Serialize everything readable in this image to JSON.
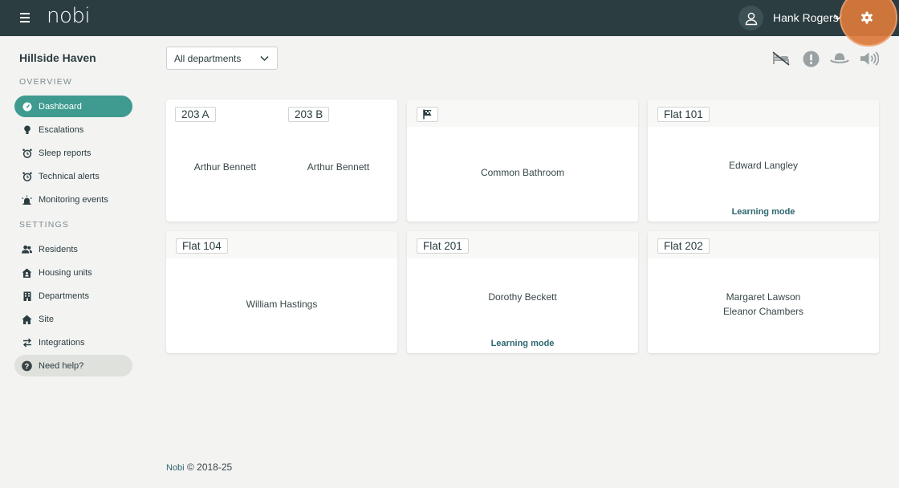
{
  "header": {
    "logo": "nobi",
    "user_name": "Hank Rogers",
    "icons": [
      "menu-icon",
      "user-icon",
      "chevron-down-icon",
      "gear-icon"
    ]
  },
  "sidebar": {
    "site_name": "Hillside Haven",
    "overview_label": "OVERVIEW",
    "settings_label": "SETTINGS",
    "overview_items": [
      {
        "label": "Dashboard",
        "icon": "gauge-icon",
        "active": true
      },
      {
        "label": "Escalations",
        "icon": "bulb-icon"
      },
      {
        "label": "Sleep reports",
        "icon": "alarm-clock-icon"
      },
      {
        "label": "Technical alerts",
        "icon": "alarm-clock-icon"
      },
      {
        "label": "Monitoring events",
        "icon": "siren-icon"
      }
    ],
    "settings_items": [
      {
        "label": "Residents",
        "icon": "users-icon"
      },
      {
        "label": "Housing units",
        "icon": "house-user-icon"
      },
      {
        "label": "Departments",
        "icon": "building-icon"
      },
      {
        "label": "Site",
        "icon": "home-icon"
      },
      {
        "label": "Integrations",
        "icon": "arrows-swap-icon"
      }
    ],
    "help_label": "Need help?"
  },
  "toolbar": {
    "department_filter": "All departments",
    "filter_icons": [
      "bed-icon",
      "alert-circle-icon",
      "hat-icon",
      "volume-icon"
    ]
  },
  "cards": [
    {
      "rooms": [
        {
          "tag": "203 A",
          "resident": "Arthur Bennett"
        },
        {
          "tag": "203 B",
          "resident": "Arthur Bennett"
        }
      ]
    },
    {
      "tag_icon": "flag-icon",
      "resident": "Common Bathroom"
    },
    {
      "tag": "Flat 101",
      "resident": "Edward Langley",
      "status": "Learning mode"
    },
    {
      "tag": "Flat 104",
      "resident": "William Hastings"
    },
    {
      "tag": "Flat 201",
      "resident": "Dorothy Beckett",
      "status": "Learning mode"
    },
    {
      "tag": "Flat 202",
      "residents": [
        "Margaret Lawson",
        "Eleanor Chambers"
      ]
    }
  ],
  "footer": {
    "brand": "Nobi",
    "copyright": "© 2018-25"
  },
  "colors": {
    "topbar": "#2b3d40",
    "accent": "#3f9b8f",
    "highlight": "#dc7a3b",
    "learning_text": "#2e6770"
  }
}
